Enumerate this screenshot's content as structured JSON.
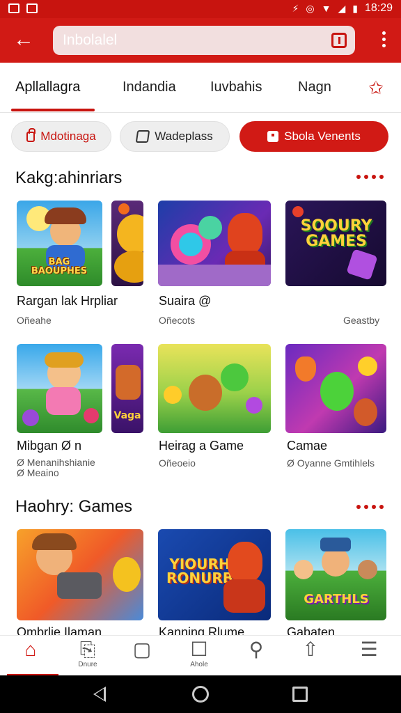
{
  "status": {
    "time": "18:29"
  },
  "appbar": {
    "search_placeholder": "Inbolalel"
  },
  "tabs": [
    {
      "label": "Apllallagra",
      "active": true
    },
    {
      "label": "Indandia"
    },
    {
      "label": "Iuvbahis"
    },
    {
      "label": "Nagn"
    }
  ],
  "chips": [
    {
      "label": "Mdotinaga",
      "icon": "lock-icon"
    },
    {
      "label": "Wadeplass",
      "icon": "ticket-icon"
    },
    {
      "label": "Sbola Venents",
      "icon": "square-icon",
      "selected": true
    }
  ],
  "sections": [
    {
      "title": "Kakg:ahinriars",
      "rows": [
        [
          {
            "title": "Rargan lak Hrpliar",
            "subtitle": "Oñeahe"
          },
          {
            "title": "Suaira @",
            "subtitle": "Oñecots"
          },
          {
            "title": "",
            "subtitle": "Geastby",
            "art_text": "SOOURY GAMES"
          }
        ],
        [
          {
            "title": "Mibgan Ø n",
            "subtitle": "Ø Menanihshianie",
            "subtitle2": "Ø Meaino"
          },
          {
            "title": "Heirag a Game",
            "subtitle": "Oñeoeio"
          },
          {
            "title": "Camae",
            "subtitle": "Ø Oyanne Gmtihlels"
          }
        ]
      ],
      "art_labels": {
        "tile1": "BAG BAOUPHES",
        "side_card": "Vaga"
      }
    },
    {
      "title": "Haohry: Games",
      "tiles": [
        {
          "title": "Ombrlie Ilaman"
        },
        {
          "title": "Kanning Rlume",
          "art_text": "YIOURH RONURB"
        },
        {
          "title": "Gabaten",
          "art_text": "GARTHLS"
        }
      ]
    }
  ],
  "bottom_nav": [
    {
      "label": "",
      "icon": "home-icon",
      "active": true
    },
    {
      "label": "Dnure",
      "icon": "bookmark-icon"
    },
    {
      "label": "",
      "icon": "tablet-icon"
    },
    {
      "label": "Ahole",
      "icon": "chat-icon"
    },
    {
      "label": "",
      "icon": "search-icon"
    },
    {
      "label": "",
      "icon": "share-icon"
    },
    {
      "label": "",
      "icon": "profile-icon"
    }
  ],
  "colors": {
    "brand_red": "#d11a15",
    "chip_bg": "#eeeeee"
  }
}
